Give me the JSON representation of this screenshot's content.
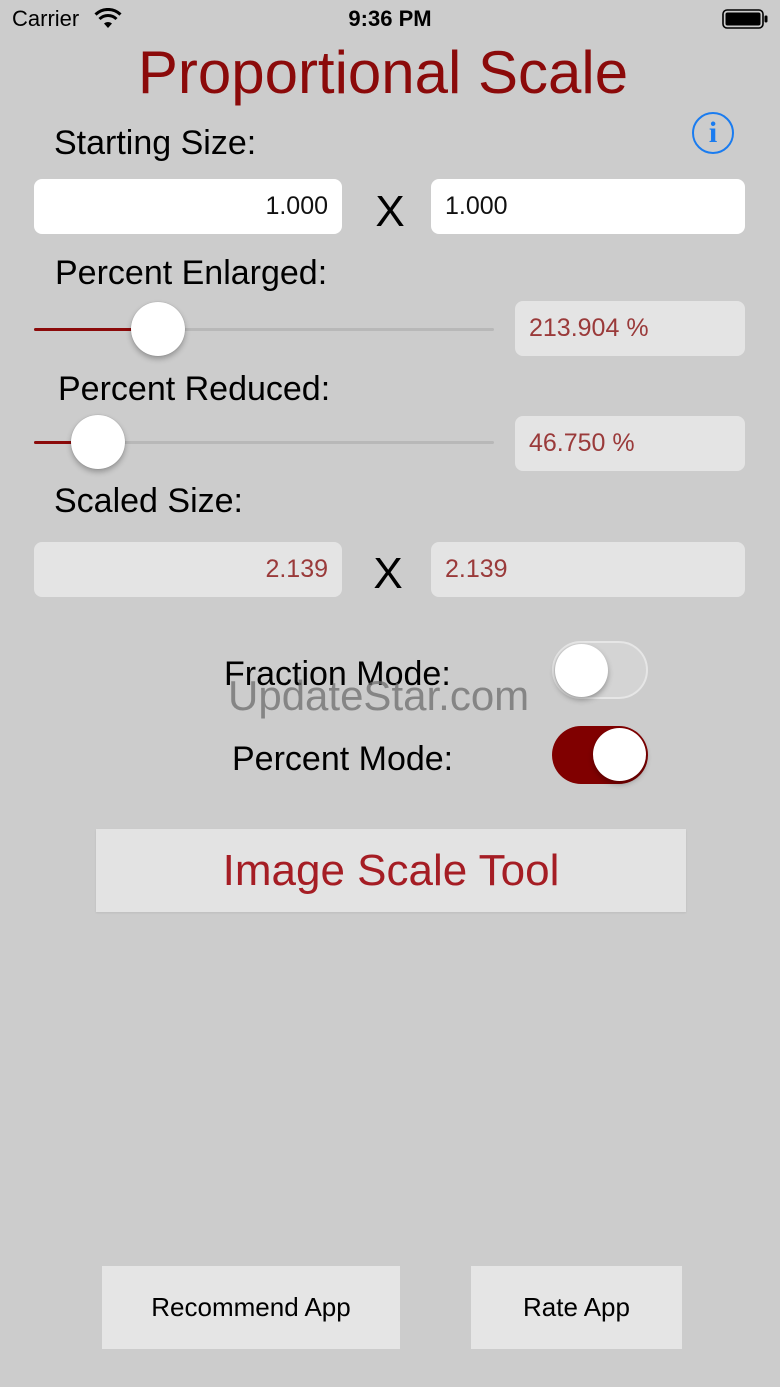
{
  "status_bar": {
    "carrier": "Carrier",
    "time": "9:36 PM",
    "wifi_icon": "wifi-icon",
    "battery_icon": "battery-icon"
  },
  "title": "Proportional Scale",
  "info_icon": {
    "glyph": "i",
    "icon": "info-icon",
    "color": "#1a7cf0"
  },
  "starting_size": {
    "label": "Starting Size:",
    "width": "1.000",
    "height": "1.000",
    "separator": "X"
  },
  "percent_enlarged": {
    "label": "Percent Enlarged:",
    "value": "213.904 %",
    "slider_fraction": 0.24
  },
  "percent_reduced": {
    "label": "Percent Reduced:",
    "value": "46.750 %",
    "slider_fraction": 0.09
  },
  "scaled_size": {
    "label": "Scaled Size:",
    "width": "2.139",
    "height": "2.139",
    "separator": "X"
  },
  "fraction_mode": {
    "label": "Fraction Mode:",
    "on": false
  },
  "percent_mode": {
    "label": "Percent Mode:",
    "on": true
  },
  "watermark": "UpdateStar.com",
  "image_scale_button": "Image Scale Tool",
  "recommend_button": "Recommend App",
  "rate_button": "Rate App",
  "colors": {
    "accent": "#8b0a0a",
    "background": "#cccccc",
    "link_blue": "#1a7cf0"
  }
}
